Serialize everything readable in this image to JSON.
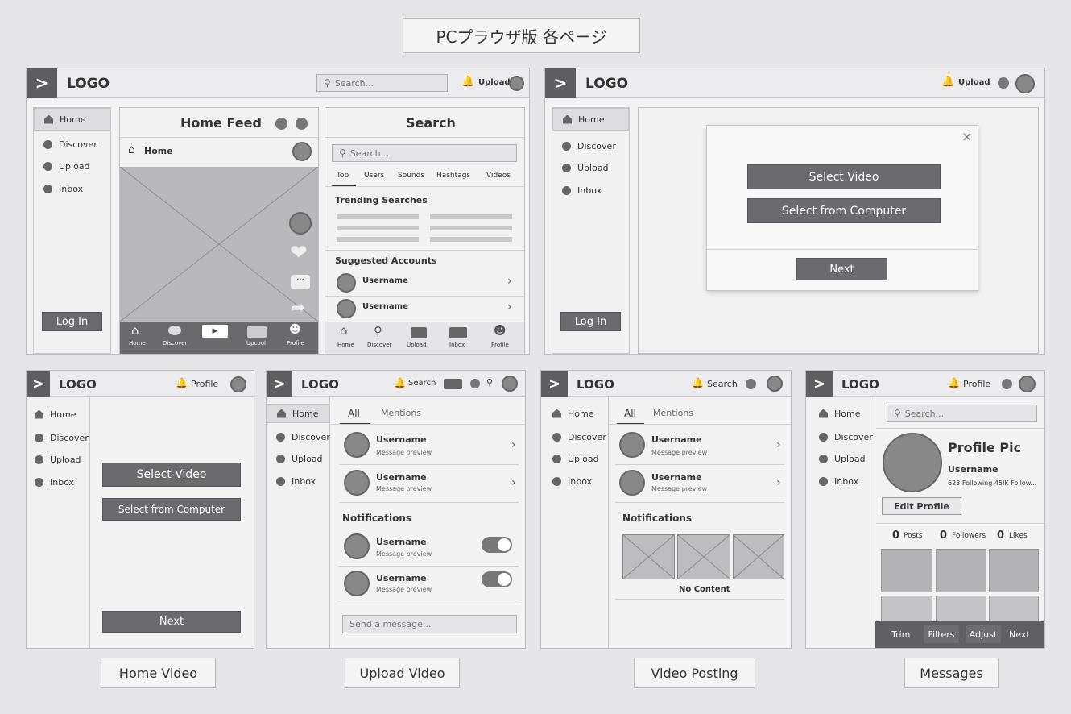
{
  "page_title": "PCプラウザ版 各ページ",
  "logo": "LOGO",
  "panel_home": {
    "search_placeholder": "Search...",
    "upload": "Upload",
    "side": [
      "Home",
      "Discover",
      "Upload",
      "Inbox"
    ],
    "login": "Log In",
    "feed_title": "Home Feed",
    "feed_sub": "Home",
    "bottom_nav": [
      "Home",
      "Discover",
      "",
      "Upcool",
      "Profile"
    ],
    "search_title": "Search",
    "search_tabs": [
      "Top",
      "Users",
      "Sounds",
      "Hashtags",
      "Videos"
    ],
    "trending": "Trending Searches",
    "suggested": "Suggested Accounts",
    "username": "Username",
    "search_nav": [
      "Home",
      "Discover",
      "Upload",
      "Inbox",
      "Profile"
    ]
  },
  "panel_upload_modal": {
    "upload": "Upload",
    "side": [
      "Home",
      "Discover",
      "Upload",
      "Inbox"
    ],
    "login": "Log In",
    "close": "×",
    "select_video": "Select Video",
    "select_computer": "Select from Computer",
    "next": "Next"
  },
  "panel_home_video": {
    "profile": "Profile",
    "side": [
      "Home",
      "Discover",
      "Upload",
      "Inbox"
    ],
    "select_video": "Select Video",
    "select_computer": "Select from Computer",
    "next": "Next",
    "label": "Home Video"
  },
  "panel_upload_video": {
    "search": "Search",
    "side": [
      "Home",
      "Discover",
      "Upload",
      "Inbox"
    ],
    "tabs": [
      "All",
      "Mentions"
    ],
    "username": "Username",
    "preview": "Message preview",
    "notifications": "Notifications",
    "send_placeholder": "Send a message...",
    "label": "Upload Video"
  },
  "panel_video_posting": {
    "search": "Search",
    "side": [
      "Home",
      "Discover",
      "Upload",
      "Inbox"
    ],
    "tabs": [
      "All",
      "Mentions"
    ],
    "username": "Username",
    "preview": "Message preview",
    "notifications": "Notifications",
    "no_content": "No Content",
    "label": "Video Posting"
  },
  "panel_messages": {
    "profile": "Profile",
    "side": [
      "Home",
      "Discover",
      "Upload",
      "Inbox"
    ],
    "search_placeholder": "Search...",
    "profile_pic": "Profile Pic",
    "username": "Username",
    "follow_info": "623 Following 45IK Follow...",
    "edit_profile": "Edit Profile",
    "stats": [
      {
        "n": "0",
        "l": "Posts"
      },
      {
        "n": "0",
        "l": "Followers"
      },
      {
        "n": "0",
        "l": "Likes"
      }
    ],
    "tools": [
      "Trim",
      "Filters",
      "Adjust",
      "Next"
    ],
    "label": "Messages"
  }
}
